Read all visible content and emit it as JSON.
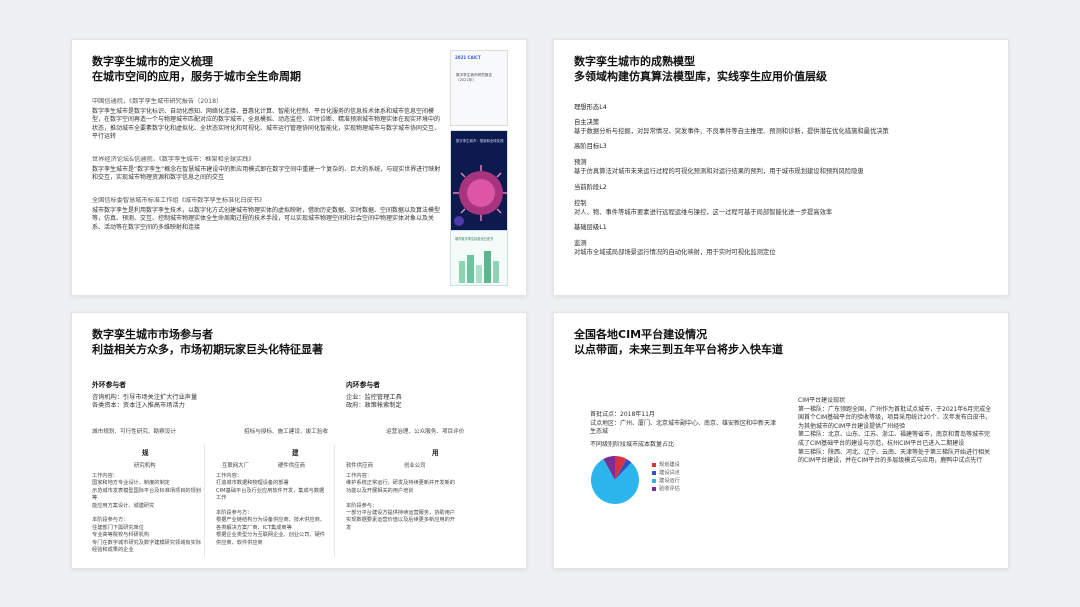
{
  "slide1": {
    "title1": "数字孪生城市的定义梳理",
    "title2": "在城市空间的应用，服务于城市全生命周期",
    "b1_head": "中国信通院，《数字孪生城市研究报告（2018）",
    "b1_body": "数字孪生城市是数字化标识、自动化感知、网络化连接、普惠化计算、智能化控制、平台化服务的信息技术体系和城市信息空间模型，在数字空间再造一个与物理城市匹配对应的数字城市，全息模拟、动态监控、实时诊断、精准预测城市物理实体在现实环境中的状态，推动城市全要素数字化和虚拟化、全状态实时化和可视化、城市运行管理协同化智能化，实现物理城市与数字城市协同交互、平行运转",
    "b2_head": "世界经济论坛&信通院，《数字孪生城市：框架和全球实践》",
    "b2_body": "数字孪生城市是“数字孪生”概念在智慧城市建设中的新应用模式即在数字空间中重建一个复杂的、巨大的系统，与现实世界进行映射和交互，实现城市物理资源和数字信息之间的交互",
    "b3_head": "全国信标委智慧城市标准工作组《城市数字孪生标准化白皮书》",
    "b3_body": "城市数字孪生是利用数字孪生技术，以数字化方式创建城市物理实体的虚拟映射，借助历史数据、实时数据、空间数据以及算法模型等，仿真、预测、交互、控制城市物理实体全生命周期过程的技术手段，可以实现城市物理空间和社会空间中物理实体对象以及关系、活动等在数字空间的多维映射和连接",
    "cover1_logo": "2021 CAICT",
    "cover1_title": "数字孪生城市研究报告（2021年）",
    "cover2_title": "数字孪生城市：框架和全球实践",
    "cover3_title": "城市数字孪生标准化白皮书"
  },
  "slide2": {
    "title1": "数字孪生城市的成熟模型",
    "title2": "多领域构建仿真算法模型库，实线孪生应用价值层级",
    "levels": [
      {
        "label": "理想形态L4",
        "desc": ""
      },
      {
        "label": "自主决策",
        "desc": "基于数据分析与挖掘，对异常情况、突发事件、不良事件等自主推理、预测和诊断，提供潜在优化措施和最优决策"
      },
      {
        "label": "高阶目标L3",
        "desc": ""
      },
      {
        "label": "预测",
        "desc": "基于仿真算法对城市未来运行过程的可视化预测和对运行结果的预判，用于城市规划建设和预判风险隐患"
      },
      {
        "label": "当前阶段L2",
        "desc": ""
      },
      {
        "label": "控制",
        "desc": "对人、物、事件等城市要素进行远程运维与操控，这一过程可基于局部智能化进一步提高效率"
      },
      {
        "label": "基础层级L1",
        "desc": ""
      },
      {
        "label": "监测",
        "desc": "对城市全域或局部场景运行情况的自动化映射，用于实时可视化监测定位"
      }
    ]
  },
  "slide3": {
    "title1": "数字孪生城市市场参与者",
    "title2": "利益相关方众多，市场初期玩家巨头化特征显著",
    "outer_head": "外环参与者",
    "outer_l1": "咨询机构：引导市场关注扩大行业声量",
    "outer_l2": "各类资本：资本注入推高市场活力",
    "inner_head": "内环参与者",
    "inner_l1": "企业：监控管理工具",
    "inner_l2": "政府：政策帐索制定",
    "row_top": [
      "城市规划、可行性研究、勘察设计",
      "招标与授标、施工建设、竣工验收",
      "运营治理、公众服务、项目评价"
    ],
    "phases": [
      "规",
      "建",
      "用"
    ],
    "subs": [
      "研究机构",
      "互联网大厂",
      "硬件供应商",
      "软件供应商",
      "创业公司"
    ],
    "col1": "工作内容：\n国家和地方专业设计、制度的制定\n示范城市发表模型国际平台及标准场项目的规划等\n能应用方案设计、城建研究\n\n本阶段参与方：\n住建部门下属研究单位\n专业高等院校与科研机构\n专门在数字城市研究及数字建模研究领域有实际经验和成果的企业",
    "col2": "工作内容：\n打造城市数据和物理设备的部署\nCIM基础平台及行业应用软件开发，集成与数据工作\n\n本阶段参与方：\n根据产业链结构分为设备供应商、技术供应商、各类解决方案厂商、ICT集成商等\n根据企业类型分为互联网企业、创业公司、硬件供应商、软件供应商",
    "col3": "工作内容：\n维护系统正常运行，研发及持续更新并开发新的功能以及开展相关的用户培训\n\n本阶段参与：\n一部分平台建设方提供持续运营服务，协助用户实现数据要素运营价值以及后续更多新应用的开发"
  },
  "slide4": {
    "title1": "全国各地CIM平台建设情况",
    "title2": "以点带面，未来三到五年平台将步入快车道",
    "text_left": "首批试点：2018年11月\n试点地区：广州、厦门、北京城市副中心、南京、雄安新区和中新天津生态城",
    "chart_caption": "不同级别阶段城市成本数量占比",
    "text_right": "CIM平台建设现状\n第一梯队：广东领跑全国，广州作为首批试点城市，于2021年6月完成全国首个CIM基础平台的验收等级，项目采用统计20个、次年发布白皮书，为其他城市的CIM平台建设提供广州经验\n第二梯队：北京、山东、江苏、浙江、福建等省市，南京和青岛等城市完成了CIM基础平台的建设与示范，杭州CIM平台已进入二期建设\n第三梯队：陕西、河北、辽宁、云南、天津等处于第三梯队开始进行相关的CIM平台建设，并在CIM平台的多层级模式与应用，鹿鸭中试点先行",
    "chart_data": {
      "type": "pie",
      "series": [
        {
          "name": "规划建设",
          "value": 8,
          "color": "#d9333f"
        },
        {
          "name": "建设试点",
          "value": 4,
          "color": "#2f4fc7"
        },
        {
          "name": "建设运行",
          "value": 80,
          "color": "#2ab6ec"
        },
        {
          "name": "验收评估",
          "value": 8,
          "color": "#7b2d9a"
        }
      ]
    }
  }
}
